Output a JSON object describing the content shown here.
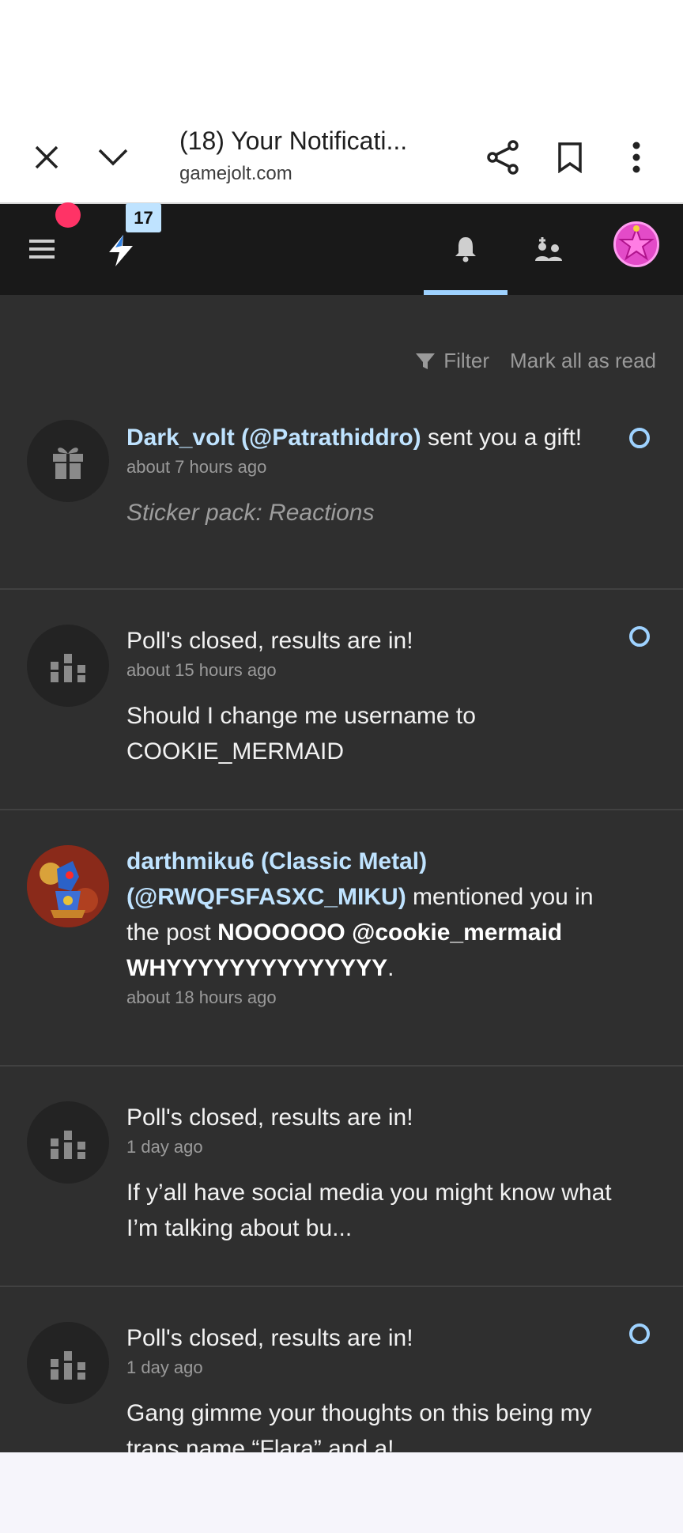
{
  "browser": {
    "title": "(18) Your Notificati...",
    "url": "gamejolt.com"
  },
  "header": {
    "activity_count": "17"
  },
  "toolbar": {
    "filter_label": "Filter",
    "mark_all_label": "Mark all as read"
  },
  "notifications": [
    {
      "user": "Dark_volt (@Patrathiddro)",
      "action": " sent you a gift!",
      "time": "about 7 hours ago",
      "excerpt": "Sticker pack: Reactions",
      "unread": true,
      "icon": "gift-icon"
    },
    {
      "action": "Poll's closed, results are in!",
      "time": "about 15 hours ago",
      "excerpt": "Should I change me username to COOKIE_MERMAID",
      "unread": true,
      "icon": "poll-icon"
    },
    {
      "user": "darthmiku6 (Classic Metal) (@RWQFSFASXC_MIKU)",
      "action": " mentioned you in the post ",
      "post": "NOOOOOO @cookie_mermaid WHYYYYYYYYYYYYYY",
      "after": ".",
      "time": "about 18 hours ago",
      "unread": false,
      "icon": "user-avatar"
    },
    {
      "action": "Poll's closed, results are in!",
      "time": "1 day ago",
      "excerpt": "If y’all have social media you might know what I’m talking about bu...",
      "unread": false,
      "icon": "poll-icon"
    },
    {
      "action": "Poll's closed, results are in!",
      "time": "1 day ago",
      "excerpt": "Gang gimme your thoughts on this being my trans name “Flara” and a!",
      "unread": true,
      "icon": "poll-icon"
    }
  ],
  "colors": {
    "page_bg": "#2f2f2f",
    "header_bg": "#191919",
    "link": "#bfe3ff",
    "accent": "#9ed2ff",
    "notify_dot": "#ff3366"
  }
}
